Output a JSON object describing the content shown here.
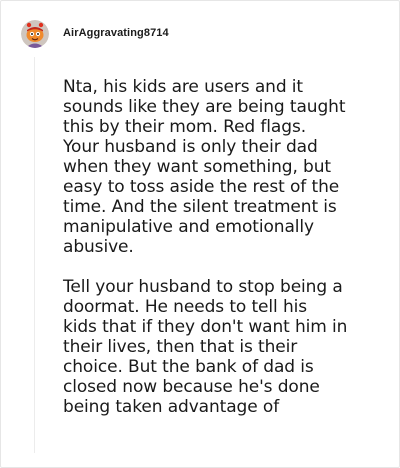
{
  "comment": {
    "username": "AirAggravating8714",
    "avatar_icon": "snoo-avatar-icon",
    "paragraphs": [
      "Nta, his kids are users and it\nsounds like they are being taught\nthis by their mom. Red flags.\nYour husband is only their dad\nwhen they want something, but\neasy to toss aside the rest of the\ntime. And the silent treatment is\nmanipulative and emotionally\nabusive.",
      "Tell your husband to stop being a\ndoormat. He needs to tell his\nkids that if they don't want him in\ntheir lives, then that is their\nchoice. But the bank of dad is\nclosed now because he's done\nbeing taken advantage of"
    ]
  }
}
